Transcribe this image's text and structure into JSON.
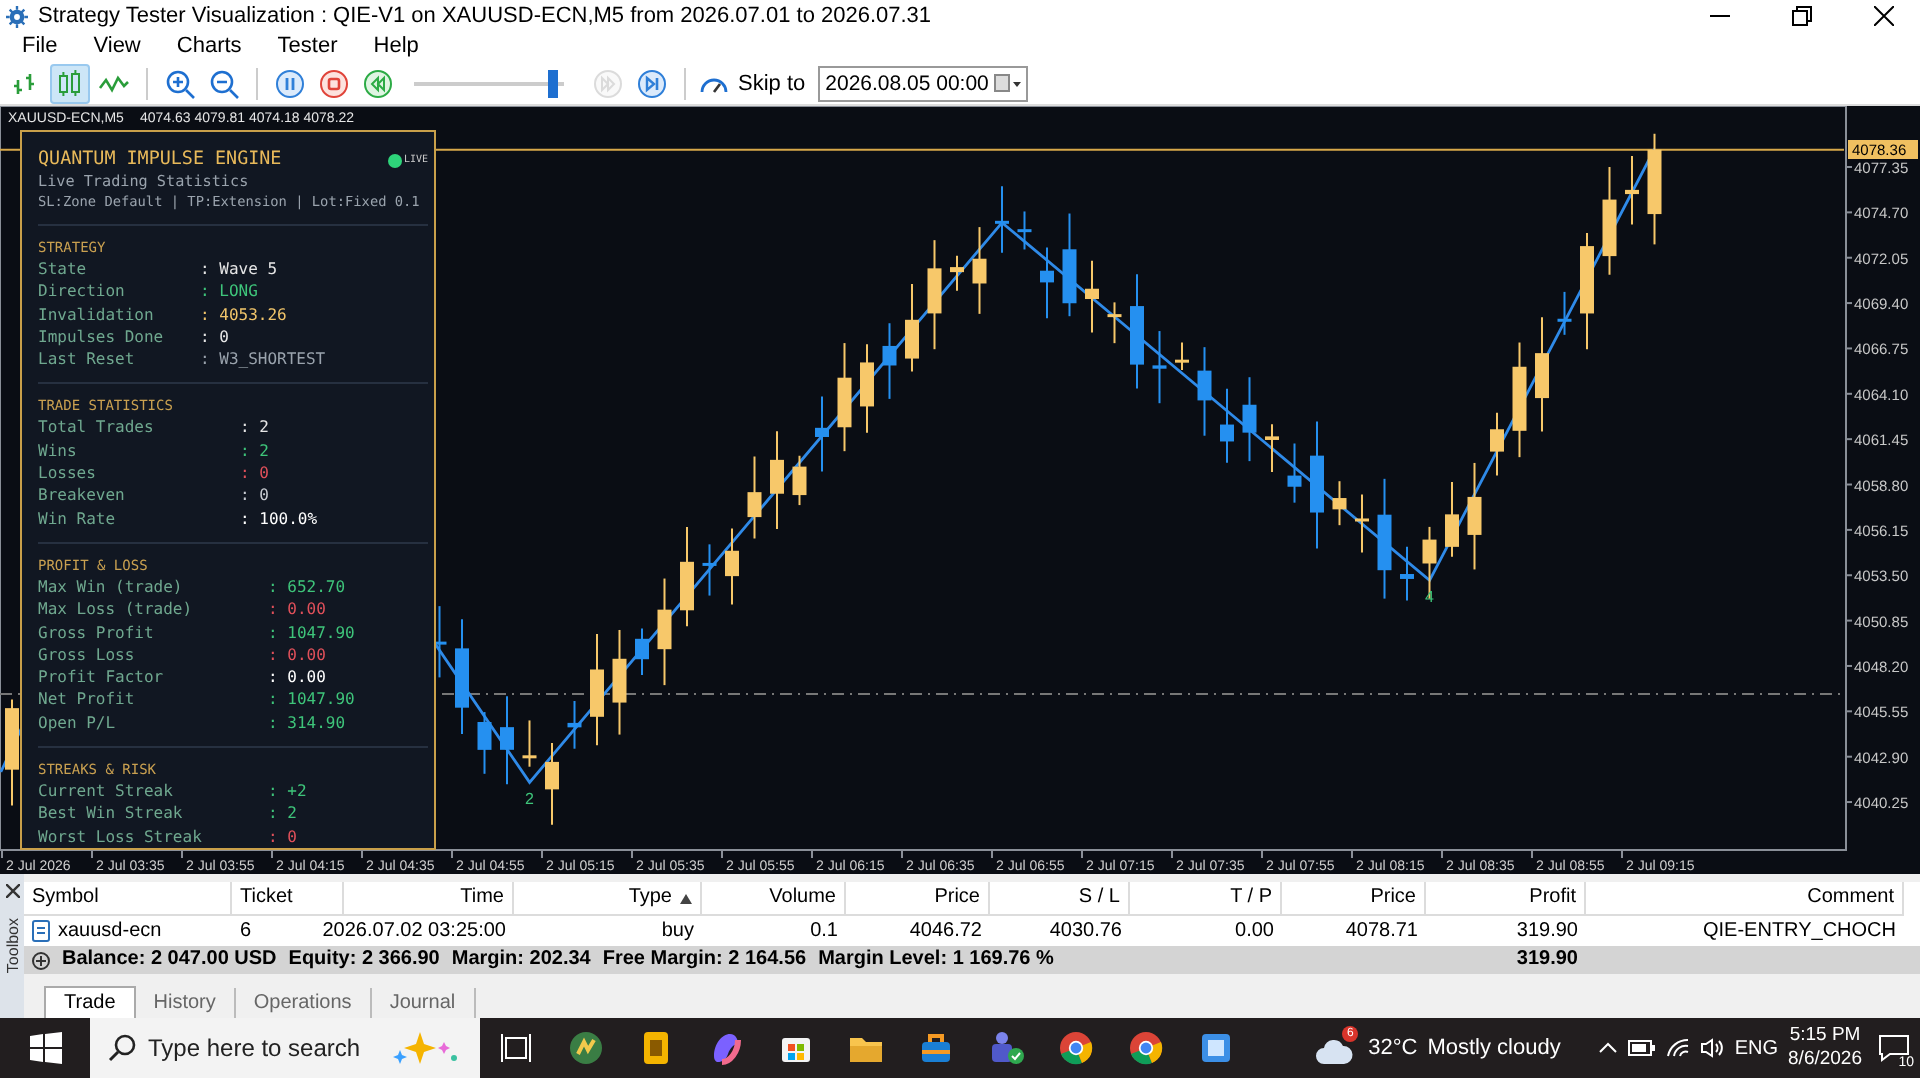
{
  "window": {
    "title": "Strategy Tester Visualization : QIE-V1 on XAUUSD-ECN,M5 from 2026.07.01 to 2026.07.31"
  },
  "menu": [
    "File",
    "View",
    "Charts",
    "Tester",
    "Help"
  ],
  "toolbar": {
    "chart_types": [
      {
        "kind": "bars",
        "selected": false
      },
      {
        "kind": "candles",
        "selected": true
      },
      {
        "kind": "line",
        "selected": false
      }
    ],
    "playback": [
      {
        "kind": "pause",
        "disabled": false
      },
      {
        "kind": "stop",
        "disabled": false
      },
      {
        "kind": "rewind",
        "disabled": false
      }
    ],
    "speed": {
      "level": 0.96
    },
    "stepping": [
      {
        "kind": "step",
        "disabled": true
      },
      {
        "kind": "end",
        "disabled": false
      }
    ],
    "skip_label": "Skip to",
    "skip_date": "2026.08.05 00:00"
  },
  "chart": {
    "symbol": "XAUUSD-ECN,M5",
    "quote": "4074.63 4079.81 4074.18 4078.22",
    "current_price": "4078.36",
    "price_ticks": [
      "4077.35",
      "4074.70",
      "4072.05",
      "4069.40",
      "4066.75",
      "4064.10",
      "4061.45",
      "4058.80",
      "4056.15",
      "4053.50",
      "4050.85",
      "4048.20",
      "4045.55",
      "4042.90",
      "4040.25"
    ],
    "time_ticks": [
      "2 Jul 2026",
      "2 Jul 03:35",
      "2 Jul 03:55",
      "2 Jul 04:15",
      "2 Jul 04:35",
      "2 Jul 04:55",
      "2 Jul 05:15",
      "2 Jul 05:35",
      "2 Jul 05:55",
      "2 Jul 06:15",
      "2 Jul 06:35",
      "2 Jul 06:55",
      "2 Jul 07:15",
      "2 Jul 07:35",
      "2 Jul 07:55",
      "2 Jul 08:15",
      "2 Jul 08:35",
      "2 Jul 08:55",
      "2 Jul 09:15"
    ],
    "wave_labels": [
      "2",
      "4"
    ]
  },
  "panel": {
    "title": "QUANTUM IMPULSE ENGINE",
    "badge": "LIVE",
    "subtitle": "Live Trading Statistics",
    "settings": "SL:Zone Default | TP:Extension | Lot:Fixed 0.1",
    "sections": [
      {
        "title": "STRATEGY",
        "rows": [
          {
            "label": "State",
            "value": ": Wave 5",
            "color": "#e6e6e6"
          },
          {
            "label": "Direction",
            "value": ": LONG",
            "color": "#3ec47a"
          },
          {
            "label": "Invalidation",
            "value": ": 4053.26",
            "color": "#f0c46a"
          },
          {
            "label": "Impulses Done",
            "value": ": 0",
            "color": "#e6e6e6"
          },
          {
            "label": "Last Reset",
            "value": ": W3_SHORTEST",
            "color": "#9aa3ad"
          }
        ]
      },
      {
        "title": "TRADE STATISTICS",
        "rows": [
          {
            "label": "Total Trades",
            "value": ": 2",
            "color": "#e6e6e6"
          },
          {
            "label": "Wins",
            "value": ": 2",
            "color": "#3ec47a"
          },
          {
            "label": "Losses",
            "value": ": 0",
            "color": "#e0505a"
          },
          {
            "label": "Breakeven",
            "value": ": 0",
            "color": "#c8ccd2"
          },
          {
            "label": "Win Rate",
            "value": ": 100.0%",
            "color": "#ffffff"
          }
        ]
      },
      {
        "title": "PROFIT & LOSS",
        "rows": [
          {
            "label": "Max Win (trade)",
            "value": ": 652.70",
            "color": "#3ec47a"
          },
          {
            "label": "Max Loss (trade)",
            "value": ": 0.00",
            "color": "#e0505a"
          },
          {
            "label": "Gross Profit",
            "value": ": 1047.90",
            "color": "#3ec47a"
          },
          {
            "label": "Gross Loss",
            "value": ": 0.00",
            "color": "#e0505a"
          },
          {
            "label": "Profit Factor",
            "value": ": 0.00",
            "color": "#ffffff"
          },
          {
            "label": "Net Profit",
            "value": ": 1047.90",
            "color": "#3ec47a"
          },
          {
            "label": "Open P/L",
            "value": ": 314.90",
            "color": "#3ec47a"
          }
        ]
      },
      {
        "title": "STREAKS & RISK",
        "rows": [
          {
            "label": "Current Streak",
            "value": ": +2",
            "color": "#3ec47a"
          },
          {
            "label": "Best Win Streak",
            "value": ": 2",
            "color": "#3ec47a"
          },
          {
            "label": "Worst Loss Streak",
            "value": ": 0",
            "color": "#e0505a"
          }
        ]
      }
    ]
  },
  "trade_table": {
    "columns": [
      {
        "label": "Symbol",
        "sorted": false
      },
      {
        "label": "Ticket",
        "sorted": false
      },
      {
        "label": "Time",
        "sorted": false
      },
      {
        "label": "Type",
        "sorted": true
      },
      {
        "label": "Volume",
        "sorted": false
      },
      {
        "label": "Price",
        "sorted": false
      },
      {
        "label": "S / L",
        "sorted": false
      },
      {
        "label": "T / P",
        "sorted": false
      },
      {
        "label": "Price",
        "sorted": false
      },
      {
        "label": "Profit",
        "sorted": false
      },
      {
        "label": "Comment",
        "sorted": false
      }
    ],
    "rows": [
      {
        "cells": [
          "xauusd-ecn",
          "6",
          "2026.07.02 03:25:00",
          "buy",
          "0.1",
          "4046.72",
          "4030.76",
          "0.00",
          "4078.71",
          "319.90",
          "QIE-ENTRY_CHOCH"
        ]
      }
    ],
    "summary": [
      "Balance: 2 047.00 USD",
      "Equity: 2 366.90",
      "Margin: 202.34",
      "Free Margin: 2 164.56",
      "Margin Level: 1 169.76 %"
    ],
    "summary_profit": "319.90"
  },
  "toolbox": {
    "label": "Toolbox"
  },
  "tabs": [
    {
      "label": "Trade",
      "selected": true
    },
    {
      "label": "History",
      "selected": false
    },
    {
      "label": "Operations",
      "selected": false
    },
    {
      "label": "Journal",
      "selected": false
    }
  ],
  "taskbar": {
    "search_placeholder": "Type here to search",
    "apps": [
      {
        "kind": "trader"
      },
      {
        "kind": "notes"
      },
      {
        "kind": "copilot"
      },
      {
        "kind": "store"
      },
      {
        "kind": "folder"
      },
      {
        "kind": "briefcase"
      },
      {
        "kind": "teams"
      },
      {
        "kind": "chrome"
      },
      {
        "kind": "chrome"
      },
      {
        "kind": "square"
      }
    ],
    "weather": {
      "badge": "6",
      "temperature": "32°C",
      "condition": "Mostly cloudy"
    },
    "language": "ENG",
    "time": "5:15 PM",
    "date": "8/6/2026",
    "notifications": "10"
  }
}
